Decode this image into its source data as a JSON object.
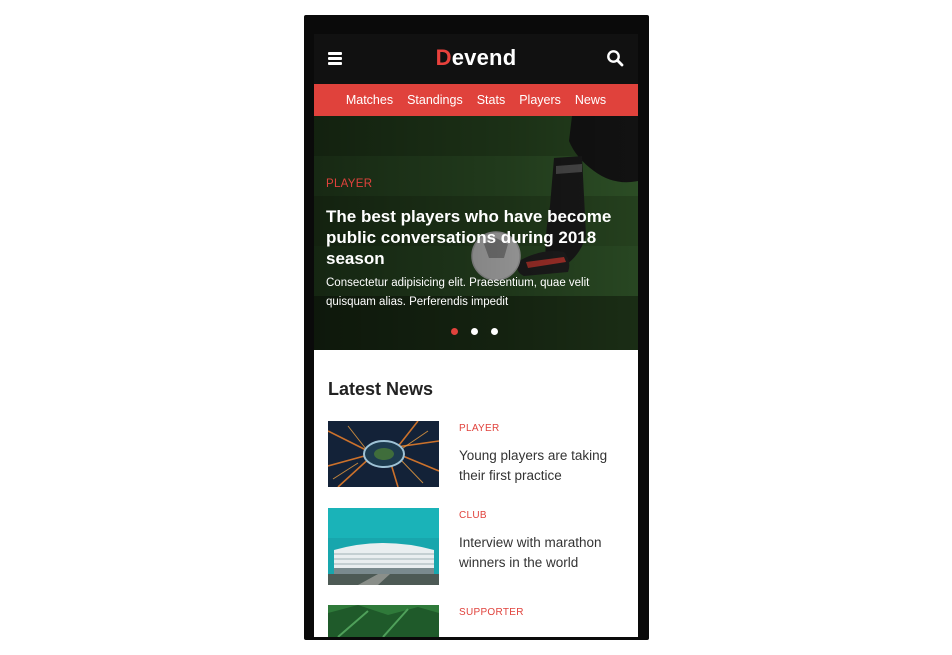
{
  "header": {
    "logo_first": "D",
    "logo_rest": "evend"
  },
  "nav": {
    "items": [
      "Matches",
      "Standings",
      "Stats",
      "Players",
      "News"
    ]
  },
  "hero": {
    "category": "PLAYER",
    "title": "The best players who have become public conversations during 2018 season",
    "text": "Consectetur adipisicing elit. Praesentium, quae velit quisquam alias. Perferendis impedit",
    "slides_total": 3,
    "active_slide": 1
  },
  "latest": {
    "heading": "Latest News",
    "items": [
      {
        "category": "PLAYER",
        "title": "Young players are taking their first practice"
      },
      {
        "category": "CLUB",
        "title": "Interview with marathon winners in the world"
      },
      {
        "category": "SUPPORTER",
        "title": ""
      }
    ]
  },
  "colors": {
    "accent": "#e0423c",
    "topbar": "#111111",
    "frame": "#0a0a0a"
  },
  "icons": {
    "menu": "hamburger-icon",
    "search": "search-icon"
  }
}
